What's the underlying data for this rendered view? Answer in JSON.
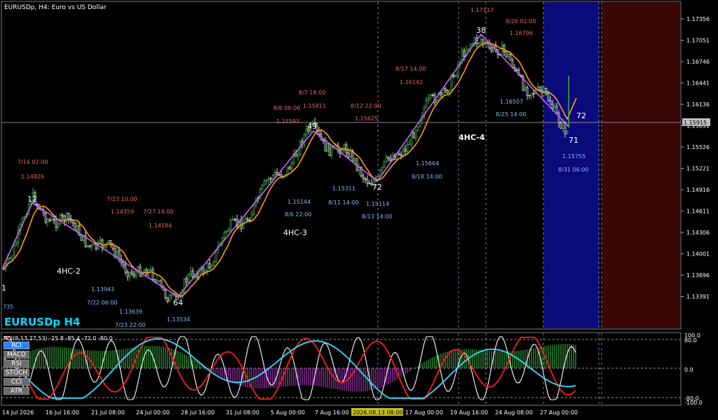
{
  "window": {
    "title": "EURUSDp, H4:  Euro vs US Dollar",
    "watermark": "EURUSDp H4"
  },
  "price_axis": {
    "labels": [
      "1.17356",
      "1.17051",
      "1.16746",
      "1.16441",
      "1.16136",
      "1.15831",
      "1.15526",
      "1.15221",
      "1.14916",
      "1.14611",
      "1.14306",
      "1.14001",
      "1.13696",
      "1.13391"
    ],
    "current_price": "1.15915"
  },
  "time_axis": {
    "labels": [
      "14 Jul 2026",
      "16 Jul 16:00",
      "21 Jul 08:00",
      "24 Jul 00:00",
      "28 Jul 16:00",
      "31 Jul 08:00",
      "5 Aug 00:00",
      "7 Aug 16:00",
      "12 Aug 08:00",
      "17 Aug 00:00",
      "19 Aug 16:00",
      "24 Aug 08:00",
      "27 Aug 00:00"
    ],
    "highlight": "2026.08.13 08:00"
  },
  "wave_labels": {
    "w1": "1",
    "w12": "12",
    "w64": "64",
    "w49": "49",
    "w72a": "72",
    "w38": "38",
    "w71": "71",
    "w72b": "72",
    "hc2": "4HC-2",
    "hc3": "4HC-3",
    "hc4": "4HC-4"
  },
  "annotations_red": {
    "a1": "7/16 02:00",
    "a2": "1.14826",
    "a3": "7/23 10:00",
    "a4": "1.14359",
    "a5": "7/27 14:00",
    "a6": "1.14184",
    "a7": "8/7 18:00",
    "a8": "8/6 06:00",
    "a9": "1.15811",
    "a10": "1.15593",
    "a11": "8/12 22:00",
    "a12": "1.15625",
    "a13": "8/17 14:00",
    "a14": "1.16142",
    "a15": "1.17117",
    "a16": "8/26 02:00",
    "a17": "1.16796"
  },
  "annotations_blue": {
    "b1": "735",
    "b2": "1.13943",
    "b3": "7/22 06:00",
    "b4": "1.13639",
    "b5": "7/23 22:00",
    "b6": "1.13534",
    "b7": "1.15144",
    "b8": "8/6 22:00",
    "b9": "1.15311",
    "b10": "8/11 14:00",
    "b11": "1.15114",
    "b12": "8/13 14:00",
    "b13": "1.15664",
    "b14": "8/18 14:00",
    "b15": "1.16507",
    "b16": "8/25 14:00",
    "b17": "1.15755",
    "b18": "8/31 06:00"
  },
  "indicator": {
    "header": "RCI(9,13,27,53) -25.8 -85.4 -72.0 -80.0",
    "buttons": [
      "RCI",
      "MACD",
      "RSI",
      "STOCH",
      "CCI",
      "ATR"
    ],
    "active_button": "RCI",
    "levels": [
      "100.0",
      "80.0",
      "0.0",
      "-80.0",
      "-100.0"
    ]
  },
  "colors": {
    "bg": "#000000",
    "grid": "#2a2a2a",
    "candle_up": "#3cb043",
    "candle_down": "#ffffff",
    "ma": "#ff9a1a",
    "zigzag": "#c864ff",
    "red_text": "#e8665a",
    "blue_text": "#86b6ff",
    "future_blue": "#0a0a7a",
    "future_red": "#3a0606"
  }
}
